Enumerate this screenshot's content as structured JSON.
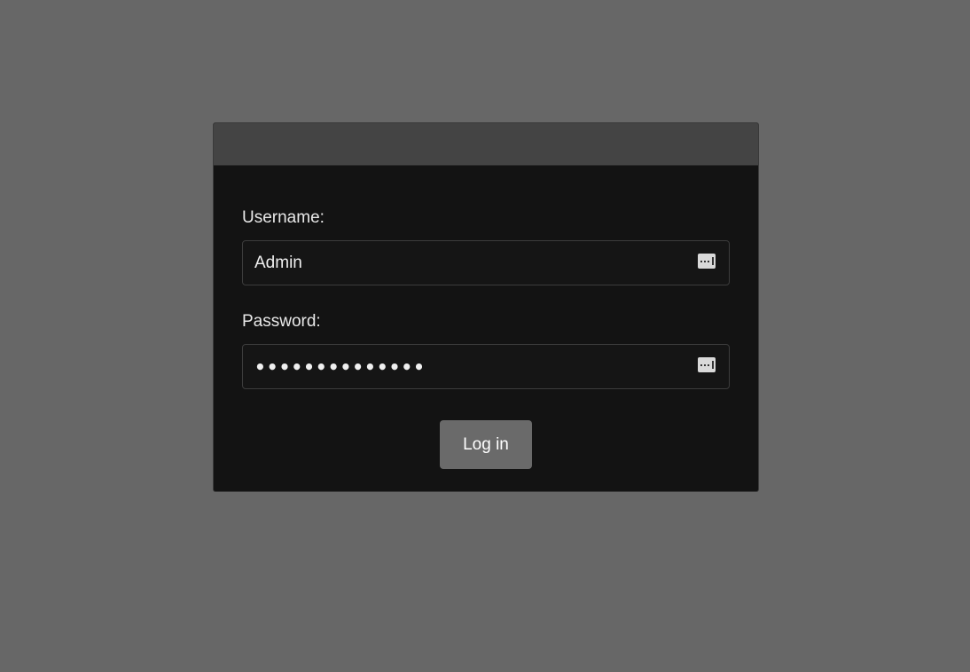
{
  "login_dialog": {
    "username": {
      "label": "Username:",
      "value": "Admin",
      "icon": "password-manager-key-icon"
    },
    "password": {
      "label": "Password:",
      "masked_value": "••••••••••••••",
      "icon": "password-manager-key-icon"
    },
    "login_button_label": "Log in"
  },
  "colors": {
    "page_background": "#676767",
    "dialog_background": "#131313",
    "dialog_header": "#444444",
    "button_background": "#6a6a6a"
  }
}
